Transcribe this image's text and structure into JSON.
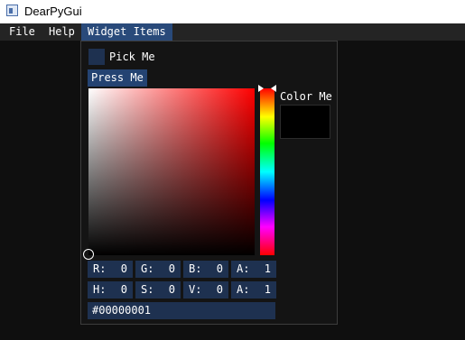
{
  "window": {
    "title": "DearPyGui"
  },
  "menubar": {
    "items": [
      "File",
      "Help",
      "Widget Items"
    ],
    "active": "Widget Items"
  },
  "popup": {
    "pick": {
      "label": "Pick Me"
    },
    "button": {
      "label": "Press Me"
    },
    "color_picker": {
      "label": "Color Me",
      "preview_color": "#000000",
      "rgba": [
        {
          "label": "R:",
          "value": "0"
        },
        {
          "label": "G:",
          "value": "0"
        },
        {
          "label": "B:",
          "value": "0"
        },
        {
          "label": "A:",
          "value": "1"
        }
      ],
      "hsva": [
        {
          "label": "H:",
          "value": "0"
        },
        {
          "label": "S:",
          "value": "0"
        },
        {
          "label": "V:",
          "value": "0"
        },
        {
          "label": "A:",
          "value": "1"
        }
      ],
      "hex": "#00000001"
    }
  },
  "colors": {
    "menubar_bg": "#242424",
    "menu_active": "#294a7a",
    "frame_bg": "#1e3150",
    "button_bg": "#244372",
    "popup_bg": "#141414"
  }
}
